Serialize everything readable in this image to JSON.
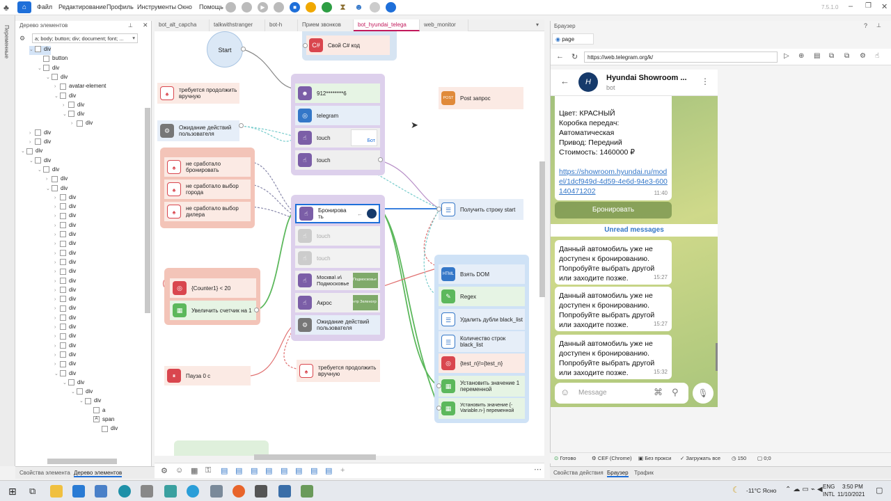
{
  "menu": {
    "items": [
      "Файл",
      "Редактирование",
      "Профиль",
      "Инструменты",
      "Окно",
      "Помощь"
    ],
    "version": "7.5.1.0"
  },
  "tree": {
    "title": "Дерево элементов",
    "filter": "a; body; button; div; document; font; ...",
    "rows": [
      {
        "depth": 1,
        "label": "div",
        "expand": "⌄",
        "sel": true
      },
      {
        "depth": 2,
        "label": "button",
        "expand": ""
      },
      {
        "depth": 2,
        "label": "div",
        "expand": "⌄"
      },
      {
        "depth": 3,
        "label": "div",
        "expand": "⌄"
      },
      {
        "depth": 4,
        "label": "avatar-element",
        "expand": "›"
      },
      {
        "depth": 4,
        "label": "div",
        "expand": "⌄"
      },
      {
        "depth": 5,
        "label": "div",
        "expand": "›"
      },
      {
        "depth": 5,
        "label": "div",
        "expand": "⌄"
      },
      {
        "depth": 6,
        "label": "div",
        "expand": "›"
      },
      {
        "depth": 1,
        "label": "div",
        "expand": "›"
      },
      {
        "depth": 1,
        "label": "div",
        "expand": "›"
      },
      {
        "depth": 0,
        "label": "div",
        "expand": "⌄"
      },
      {
        "depth": 1,
        "label": "div",
        "expand": "⌄"
      },
      {
        "depth": 2,
        "label": "div",
        "expand": "⌄"
      },
      {
        "depth": 3,
        "label": "div",
        "expand": "›"
      },
      {
        "depth": 3,
        "label": "div",
        "expand": "⌄"
      },
      {
        "depth": 4,
        "label": "div",
        "expand": "›"
      },
      {
        "depth": 4,
        "label": "div",
        "expand": "›"
      },
      {
        "depth": 4,
        "label": "div",
        "expand": "›"
      },
      {
        "depth": 4,
        "label": "div",
        "expand": "›"
      },
      {
        "depth": 4,
        "label": "div",
        "expand": "›"
      },
      {
        "depth": 4,
        "label": "div",
        "expand": "›"
      },
      {
        "depth": 4,
        "label": "div",
        "expand": "›"
      },
      {
        "depth": 4,
        "label": "div",
        "expand": "›"
      },
      {
        "depth": 4,
        "label": "div",
        "expand": "›"
      },
      {
        "depth": 4,
        "label": "div",
        "expand": "›"
      },
      {
        "depth": 4,
        "label": "div",
        "expand": "›"
      },
      {
        "depth": 4,
        "label": "div",
        "expand": "›"
      },
      {
        "depth": 4,
        "label": "div",
        "expand": "›"
      },
      {
        "depth": 4,
        "label": "div",
        "expand": "›"
      },
      {
        "depth": 4,
        "label": "div",
        "expand": "›"
      },
      {
        "depth": 4,
        "label": "div",
        "expand": "›"
      },
      {
        "depth": 4,
        "label": "div",
        "expand": "›"
      },
      {
        "depth": 4,
        "label": "div",
        "expand": "›"
      },
      {
        "depth": 4,
        "label": "div",
        "expand": "›"
      },
      {
        "depth": 4,
        "label": "div",
        "expand": "⌄"
      },
      {
        "depth": 5,
        "label": "div",
        "expand": "⌄"
      },
      {
        "depth": 6,
        "label": "div",
        "expand": "⌄"
      },
      {
        "depth": 7,
        "label": "div",
        "expand": "⌄"
      },
      {
        "depth": 8,
        "label": "a",
        "expand": ""
      },
      {
        "depth": 8,
        "label": "span",
        "expand": "",
        "tag": "A"
      },
      {
        "depth": 9,
        "label": "div",
        "expand": ""
      }
    ],
    "bottom_tabs": [
      "Свойства элемента",
      "Дерево элементов"
    ]
  },
  "vertical_tab": "Переменные",
  "tabs": [
    {
      "label": "bot_alt_capcha",
      "active": false
    },
    {
      "label": "talkwithstranger",
      "active": false
    },
    {
      "label": "bot-h",
      "active": false
    },
    {
      "label": "Прием звонков",
      "active": false
    },
    {
      "label": "bot_hyundai_telega",
      "active": true
    },
    {
      "label": "web_monitor",
      "active": false
    }
  ],
  "nodes": {
    "start": "Start",
    "csharp": "Свой C# код",
    "phone": "912********6",
    "telegram": "telegram",
    "touch1": "touch",
    "touch2": "touch",
    "thumb_label": "Бот",
    "post": "Post запрос",
    "manual1": "требуется продолжить вручную",
    "wait1": "Ожидание действий пользователя",
    "fail_book": "не сработало бронировать",
    "fail_city": "не сработало выбор города",
    "fail_dealer": "не сработало выбор дилера",
    "book": "Бронирова ть",
    "touch3": "touch",
    "touch4": "touch",
    "moscow": "Москва\\ и\\ Подмосковье",
    "moscow_thumb": "Подмосковье",
    "akros": "Акрос",
    "akros_thumb": "нтр Зеленогр",
    "wait2": "Ожидание действий пользователя",
    "counter": "{Counter1} < 20",
    "inc": "Увеличить счетчик на 1",
    "pause": "Пауза 0 с",
    "manual2": "требуется продолжить вручную",
    "getstr": "Получить строку start",
    "dom": "Взять DOM",
    "regex": "Regex",
    "dedup": "Удалить дубли black_list",
    "count": "Количество строк black_list",
    "cond": "{test_n}!={test_n}",
    "setvar1": "Установить значение 1 переменной",
    "setvar2": "Установить значение {-Variable.n-} переменной",
    "html_badge": "HTML",
    "post_badge": "POST"
  },
  "browser": {
    "title": "Браузер",
    "tab": "page",
    "url": "https://web.telegram.org/k/",
    "chat_name": "Hyundai Showroom ...",
    "chat_sub": "bot",
    "details": [
      "Цвет: КРАСНЫЙ",
      "Коробка передач:",
      "Автоматическая",
      "Привод: Передний",
      "Стоимость: 1460000 ₽"
    ],
    "link": "https://showroom.hyundai.ru/model/1dcf949d-4d59-4e6d-94e3-600140471202",
    "link_time": "11:40",
    "book_button": "Бронировать",
    "unread": "Unread messages",
    "messages": [
      {
        "text": "Данный автомобиль уже не доступен к бронированию. Попробуйте выбрать другой или заходите позже.",
        "time": "15:27"
      },
      {
        "text": "Данный автомобиль уже не доступен к бронированию. Попробуйте выбрать другой или заходите позже.",
        "time": "15:27"
      },
      {
        "text": "Данный автомобиль уже не доступен к бронированию. Попробуйте выбрать другой или заходите позже.",
        "time": "15:32"
      }
    ],
    "input_placeholder": "Message",
    "status": [
      "Готово",
      "CEF (Chrome)",
      "Без прокси",
      "Загружать все",
      "150",
      "0;0"
    ],
    "bottom_tabs": [
      "Свойства действия",
      "Браузер",
      "Трафик"
    ]
  },
  "taskbar": {
    "lang1": "ENG",
    "lang2": "INTL",
    "time": "3:50 PM",
    "date": "11/10/2021",
    "weather": "-11°C Ясно"
  }
}
